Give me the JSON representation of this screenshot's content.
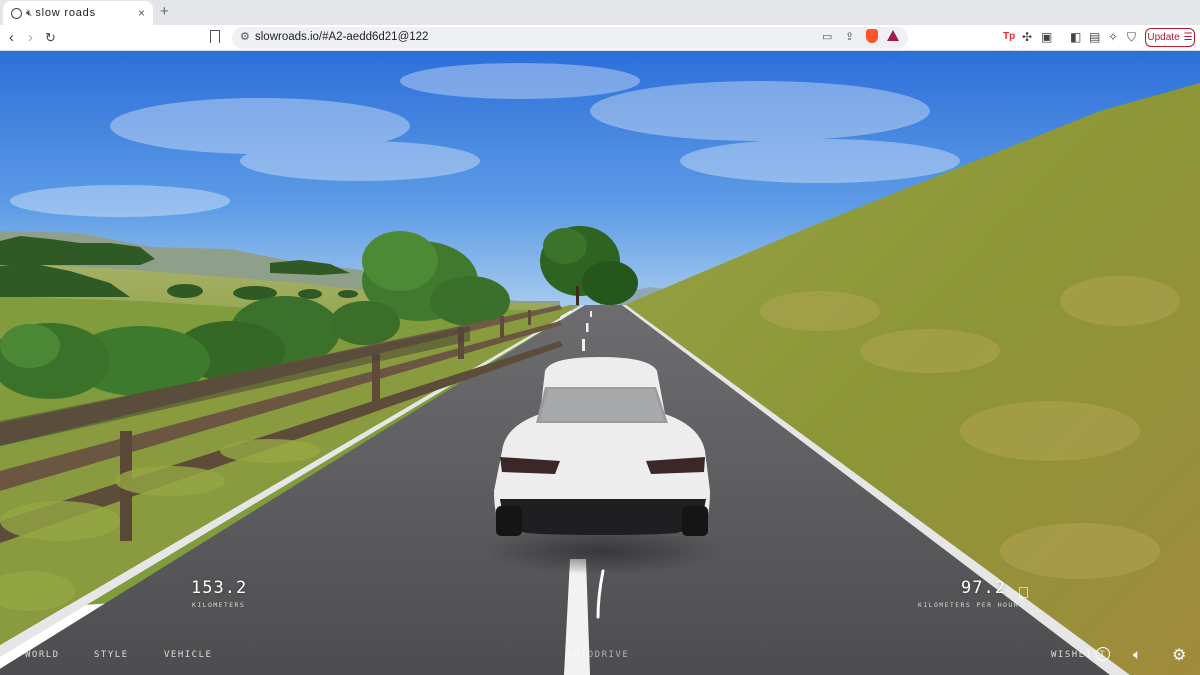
{
  "browser": {
    "tab_title": "slow roads",
    "tab_close": "×",
    "new_tab": "+",
    "url": "slowroads.io/#A2-aedd6d21@122",
    "update_label": "Update"
  },
  "hud": {
    "distance_value": "153.2",
    "distance_unit": "KILOMETERS",
    "speed_value": "97.2",
    "speed_unit": "KILOMETERS PER HOUR",
    "menu": {
      "world": "WORLD",
      "style": "STYLE",
      "vehicle": "VEHICLE",
      "autodrive": "AUTODRIVE",
      "wishlist": "WISHLIST"
    }
  },
  "colors": {
    "sky_top": "#2f73dc",
    "sky_bottom": "#8bbbe8",
    "road": "#5a5a5c",
    "grass": "#8e9a3a",
    "car": "#ececec",
    "update_accent": "#b5172f"
  },
  "icons": [
    "tab-favicon-icon",
    "mute-icon",
    "back-icon",
    "forward-icon",
    "reload-icon",
    "bookmark-icon",
    "site-settings-icon",
    "cast-icon",
    "share-icon",
    "brave-shields-icon",
    "brave-rewards-icon",
    "extensions-icon",
    "sidebar-icon",
    "wallet-icon",
    "leo-ai-icon",
    "vpn-icon",
    "menu-icon",
    "steam-icon",
    "volume-icon",
    "settings-gear-icon"
  ]
}
